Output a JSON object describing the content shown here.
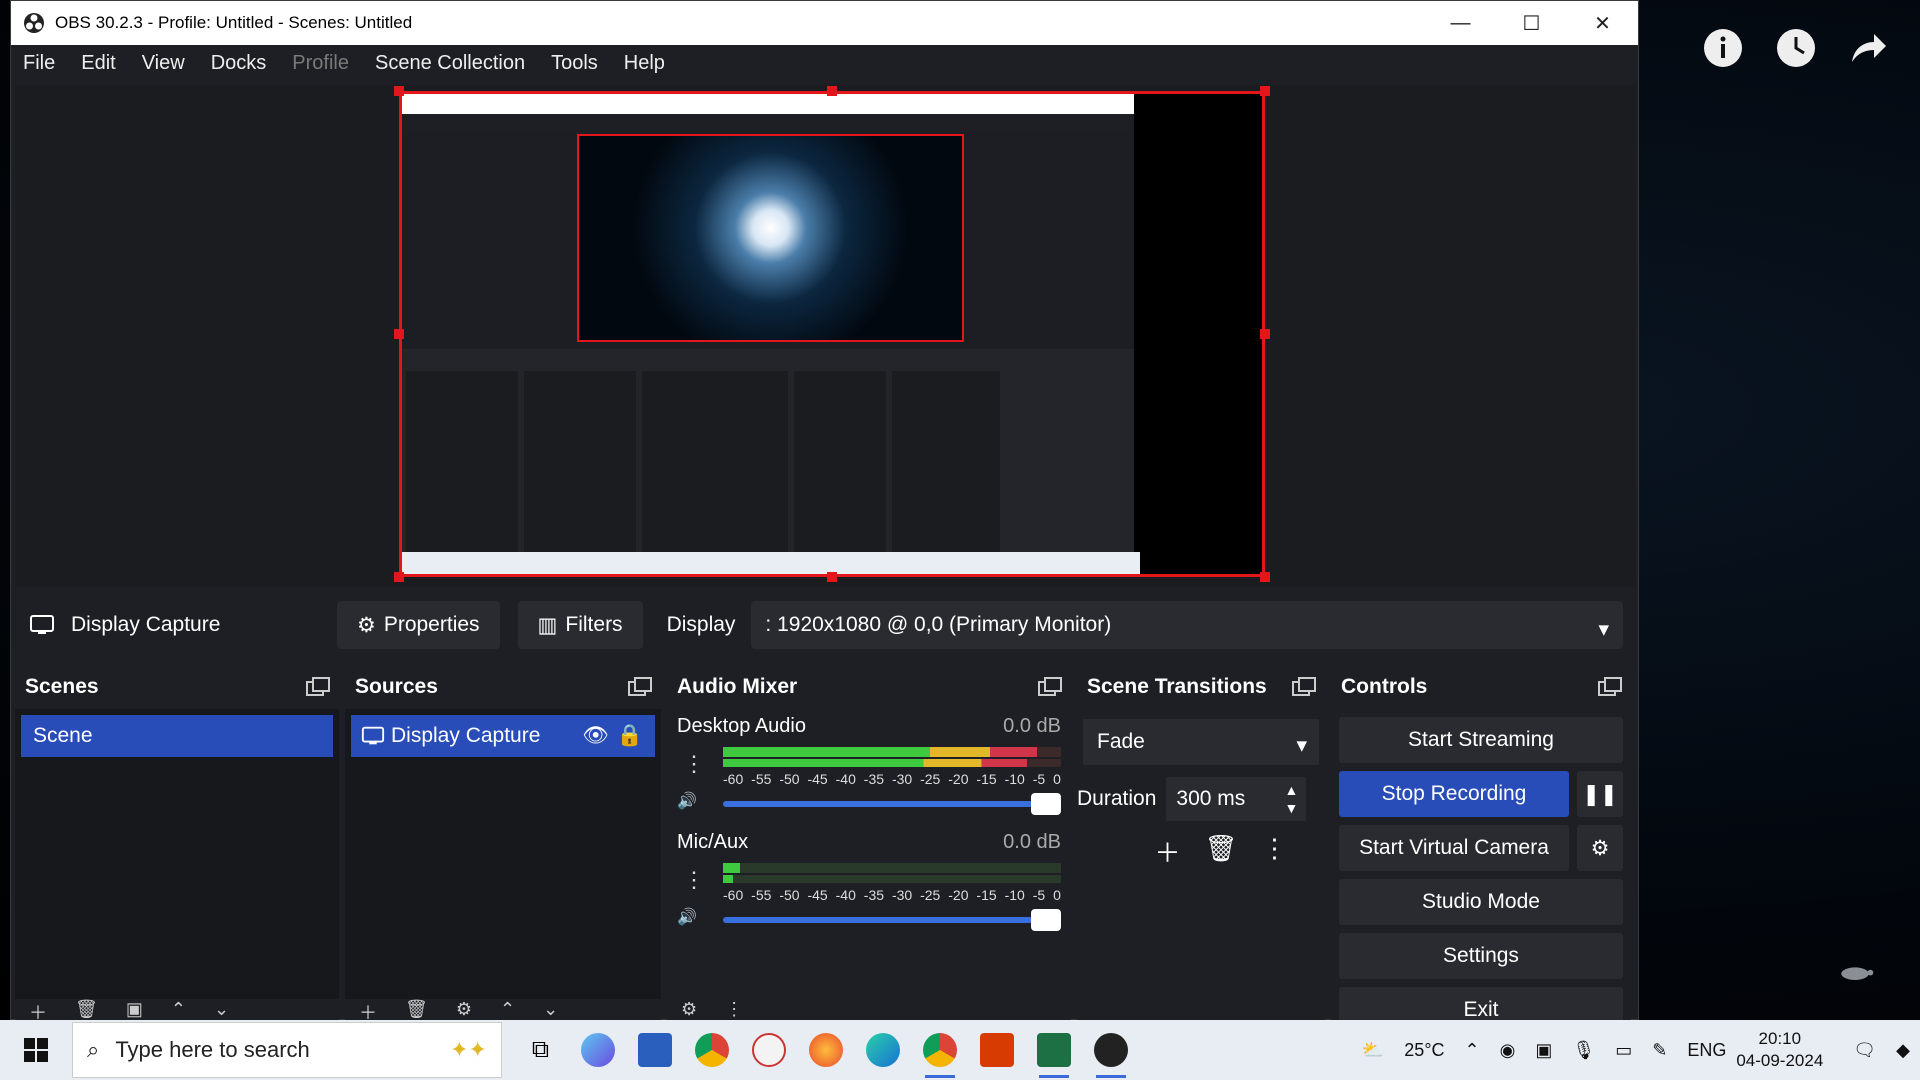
{
  "window": {
    "title": "OBS 30.2.3 - Profile: Untitled - Scenes: Untitled",
    "controls": {
      "minimize": "—",
      "maximize": "☐",
      "close": "✕"
    }
  },
  "menu": {
    "items": [
      "File",
      "Edit",
      "View",
      "Docks",
      "Profile",
      "Scene Collection",
      "Tools",
      "Help"
    ],
    "disabled_index": 4
  },
  "source_toolbar": {
    "source_name": "Display Capture",
    "properties_label": "Properties",
    "filters_label": "Filters",
    "display_label": "Display",
    "display_value": ": 1920x1080 @ 0,0 (Primary Monitor)"
  },
  "scenes": {
    "title": "Scenes",
    "items": [
      "Scene"
    ]
  },
  "sources": {
    "title": "Sources",
    "items": [
      "Display Capture"
    ]
  },
  "audio_mixer": {
    "title": "Audio Mixer",
    "channels": [
      {
        "name": "Desktop Audio",
        "db": "0.0 dB",
        "level": 0.93
      },
      {
        "name": "Mic/Aux",
        "db": "0.0 dB",
        "level": 0.05
      }
    ],
    "scale": [
      "-60",
      "-55",
      "-50",
      "-45",
      "-40",
      "-35",
      "-30",
      "-25",
      "-20",
      "-15",
      "-10",
      "-5",
      "0"
    ]
  },
  "scene_transitions": {
    "title": "Scene Transitions",
    "transition": "Fade",
    "duration_label": "Duration",
    "duration_value": "300 ms"
  },
  "controls": {
    "title": "Controls",
    "start_streaming": "Start Streaming",
    "stop_recording": "Stop Recording",
    "start_virtual_camera": "Start Virtual Camera",
    "studio_mode": "Studio Mode",
    "settings": "Settings",
    "exit": "Exit"
  },
  "taskbar": {
    "search_placeholder": "Type here to search",
    "weather": "25°C",
    "language": "ENG",
    "time": "20:10",
    "date": "04-09-2024"
  },
  "colors": {
    "accent": "#284cb8",
    "selection_border": "#e3161c",
    "meter_green": "#3ec93e",
    "meter_yellow": "#e2b829",
    "meter_red": "#d0354a"
  }
}
